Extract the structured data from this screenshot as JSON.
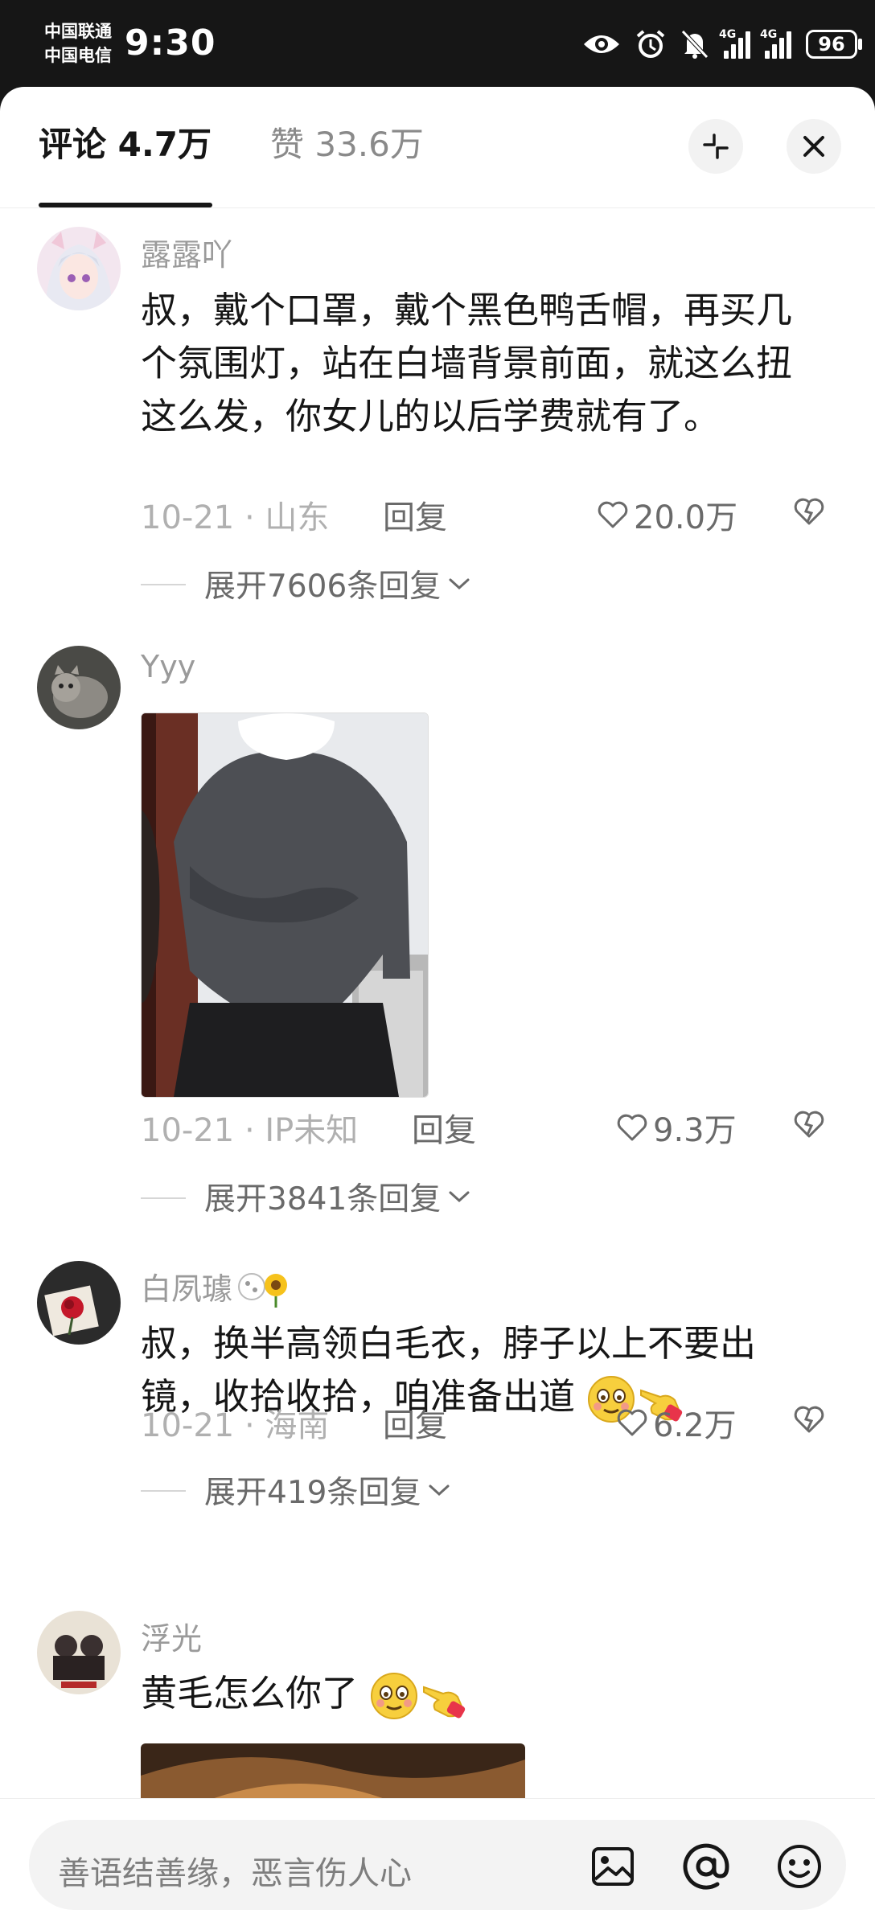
{
  "status_bar": {
    "carrier_1": "中国联通",
    "carrier_2": "中国电信",
    "time": "9:30",
    "network_1": "4G",
    "network_2": "4G",
    "battery": "96",
    "icons": [
      "eye-icon",
      "alarm-icon",
      "mute-bell-icon",
      "signal-icon",
      "signal-icon",
      "battery-icon"
    ]
  },
  "header": {
    "tab_comments": "评论 4.7万",
    "tab_likes": "赞 33.6万",
    "icons": [
      "collapse-icon",
      "close-icon"
    ]
  },
  "comments": [
    {
      "username": "露露吖",
      "text": "叔，戴个口罩，戴个黑色鸭舌帽，再买几个氛围灯，站在白墙背景前面，就这么扭这么发，你女儿的以后学费就有了。",
      "date_location": "10-21 · 山东",
      "reply": "回复",
      "likes": "20.0万",
      "expand": "展开7606条回复"
    },
    {
      "username": "Yyy",
      "date_location": "10-21 · IP未知",
      "reply": "回复",
      "likes": "9.3万",
      "expand": "展开3841条回复"
    },
    {
      "username": "白夙璩",
      "text": "叔，换半高领白毛衣，脖子以上不要出镜，收拾收拾，咱准备出道",
      "date_location": "10-21 · 海南",
      "reply": "回复",
      "likes": "6.2万",
      "expand": "展开419条回复"
    },
    {
      "username": "浮光",
      "text": "黄毛怎么你了"
    }
  ],
  "composer": {
    "placeholder": "善语结善缘，恶言伤人心",
    "icons": [
      "image-icon",
      "at-icon",
      "emoji-icon"
    ]
  },
  "colors": {
    "text": "#161616",
    "muted": "#9a9a9a",
    "background": "#ffffff",
    "status_bar": "#161616"
  }
}
